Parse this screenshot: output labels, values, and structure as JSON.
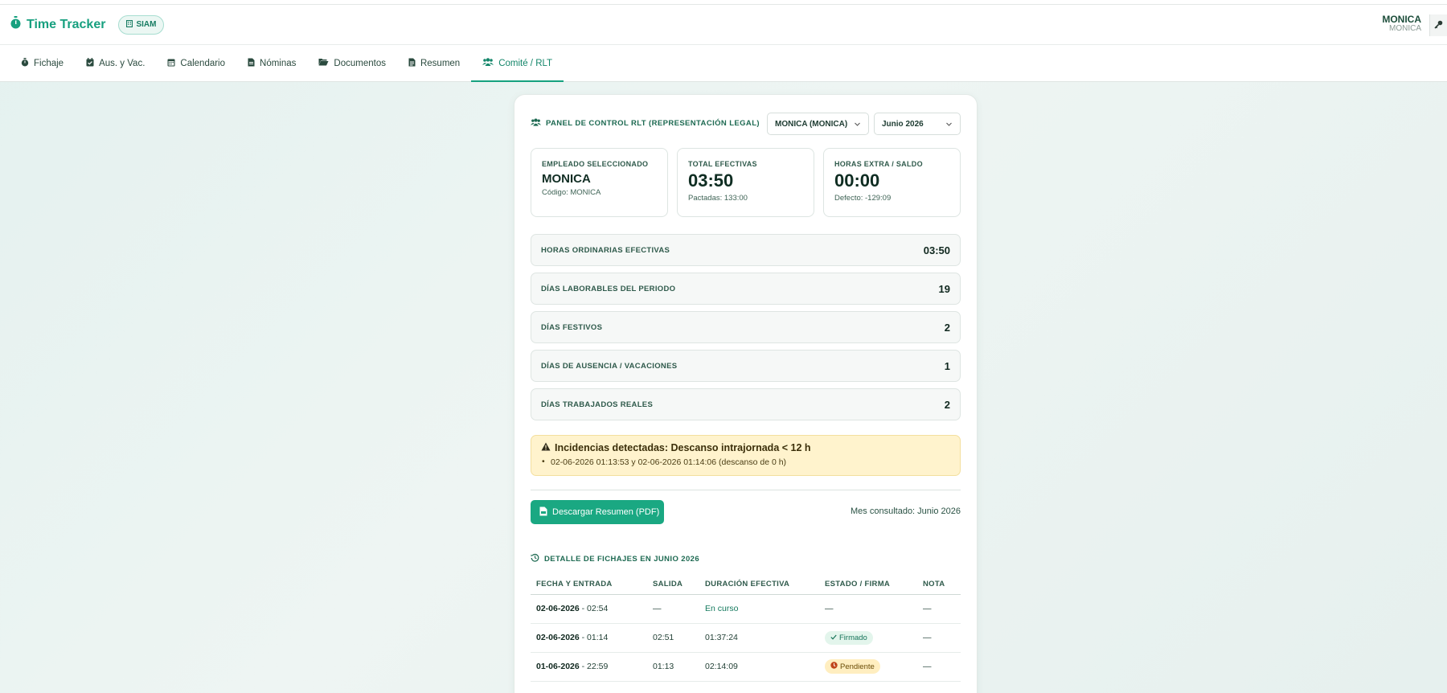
{
  "app": {
    "title": "Time Tracker",
    "badge": "SIAM",
    "brand_color": "#17a07f"
  },
  "user": {
    "name": "MONICA",
    "sub": "MONICA"
  },
  "tabs": [
    {
      "label": "Fichaje",
      "icon": "stopwatch-icon"
    },
    {
      "label": "Aus. y Vac.",
      "icon": "calendar-check-icon"
    },
    {
      "label": "Calendario",
      "icon": "calendar-icon"
    },
    {
      "label": "Nóminas",
      "icon": "file-invoice-icon"
    },
    {
      "label": "Documentos",
      "icon": "folder-open-icon"
    },
    {
      "label": "Resumen",
      "icon": "file-icon"
    },
    {
      "label": "Comité / RLT",
      "icon": "users-icon",
      "active": true
    }
  ],
  "panel": {
    "title": "PANEL DE CONTROL RLT (REPRESENTACIÓN LEGAL)",
    "employee_select": "MONICA (MONICA)",
    "month_select": "Junio 2026"
  },
  "stats": {
    "employee": {
      "label": "EMPLEADO SELECCIONADO",
      "value": "MONICA",
      "sub": "Código: MONICA"
    },
    "total": {
      "label": "TOTAL EFECTIVAS",
      "value": "03:50",
      "sub": "Pactadas: 133:00"
    },
    "extra": {
      "label": "HORAS EXTRA / SALDO",
      "value": "00:00",
      "sub": "Defecto: -129:09"
    }
  },
  "summary_rows": [
    {
      "label": "HORAS ORDINARIAS EFECTIVAS",
      "value": "03:50"
    },
    {
      "label": "DÍAS LABORABLES DEL PERIODO",
      "value": "19"
    },
    {
      "label": "DÍAS FESTIVOS",
      "value": "2"
    },
    {
      "label": "DÍAS DE AUSENCIA / VACACIONES",
      "value": "1"
    },
    {
      "label": "DÍAS TRABAJADOS REALES",
      "value": "2"
    }
  ],
  "alert": {
    "title": "Incidencias detectadas: Descanso intrajornada < 12 h",
    "items": [
      "02-06-2026 01:13:53 y 02-06-2026 01:14:06 (descanso de 0 h)"
    ]
  },
  "actions": {
    "download_label": "Descargar Resumen (PDF)",
    "month_consulted": "Mes consultado: Junio 2026"
  },
  "detail": {
    "title": "DETALLE DE FICHAJES EN JUNIO 2026",
    "columns": [
      "FECHA Y ENTRADA",
      "SALIDA",
      "DURACIÓN EFECTIVA",
      "ESTADO / FIRMA",
      "NOTA"
    ],
    "rows": [
      {
        "date": "02-06-2026",
        "entry": "- 02:54",
        "exit": "—",
        "duration": "En curso",
        "status": "—",
        "status_type": "none",
        "note": "—"
      },
      {
        "date": "02-06-2026",
        "entry": "- 01:14",
        "exit": "02:51",
        "duration": "01:37:24",
        "status": "Firmado",
        "status_type": "signed",
        "note": "—"
      },
      {
        "date": "01-06-2026",
        "entry": "- 22:59",
        "exit": "01:13",
        "duration": "02:14:09",
        "status": "Pendiente",
        "status_type": "pending",
        "note": "—"
      }
    ]
  }
}
